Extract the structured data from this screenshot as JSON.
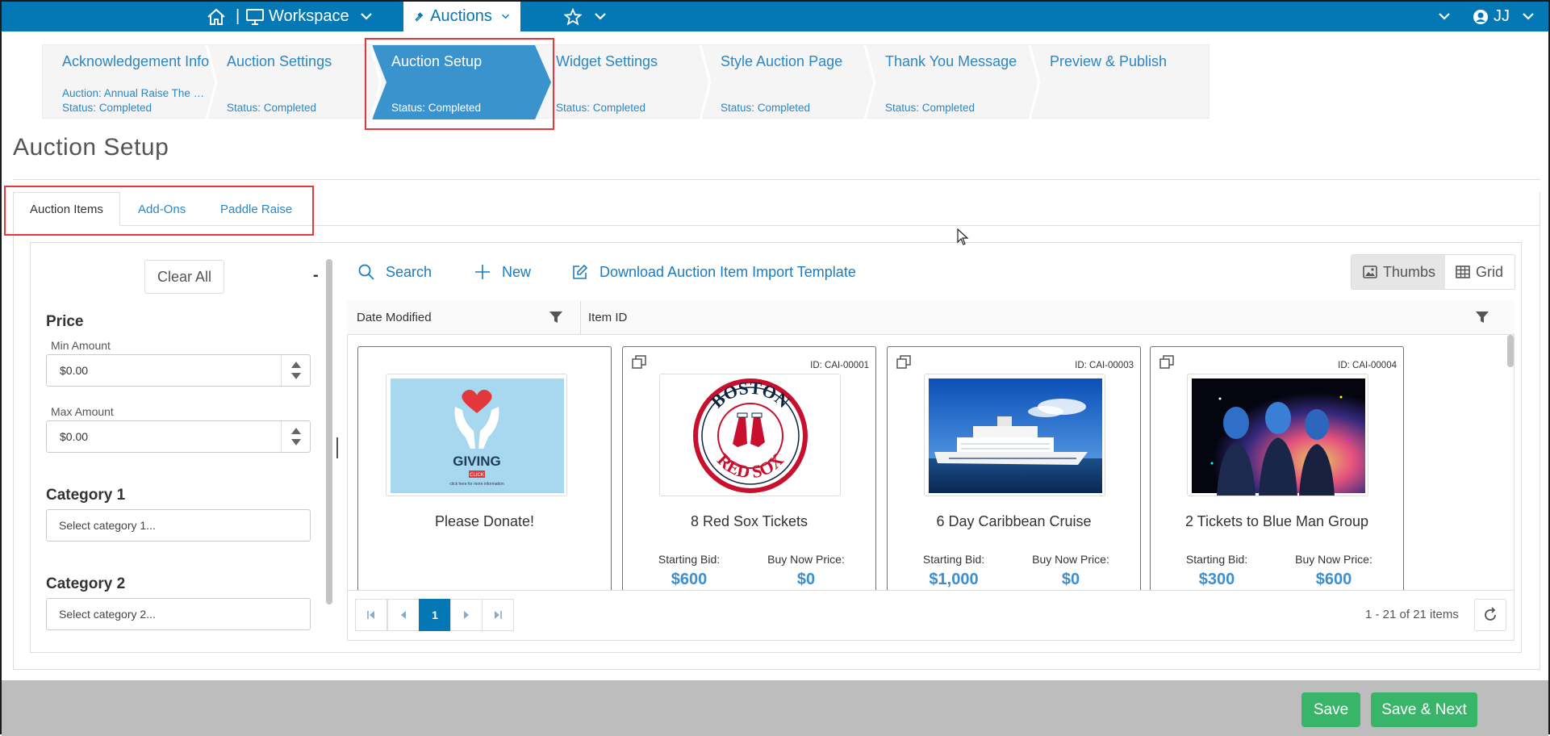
{
  "topnav": {
    "workspace_label": "Workspace",
    "auctions_label": "Auctions",
    "user_initials": "JJ",
    "separator": "|"
  },
  "wizard": {
    "steps": [
      {
        "title": "Acknowledgement Info",
        "subtitle": "Auction: Annual Raise The Paddle",
        "status": "Status: Completed"
      },
      {
        "title": "Auction Settings",
        "subtitle": "",
        "status": "Status: Completed"
      },
      {
        "title": "Auction Setup",
        "subtitle": "",
        "status": "Status: Completed"
      },
      {
        "title": "Widget Settings",
        "subtitle": "",
        "status": "Status: Completed"
      },
      {
        "title": "Style Auction Page",
        "subtitle": "",
        "status": "Status: Completed"
      },
      {
        "title": "Thank You Message",
        "subtitle": "",
        "status": "Status: Completed"
      },
      {
        "title": "Preview & Publish",
        "subtitle": "",
        "status": ""
      }
    ],
    "current_index": 2
  },
  "page": {
    "title": "Auction Setup"
  },
  "tabs": [
    "Auction Items",
    "Add-Ons",
    "Paddle Raise"
  ],
  "filters": {
    "clear_all": "Clear All",
    "collapse": "-",
    "price_label": "Price",
    "min_label": "Min Amount",
    "min_value": "$0.00",
    "max_label": "Max Amount",
    "max_value": "$0.00",
    "category1_label": "Category 1",
    "category1_placeholder": "Select category 1...",
    "category2_label": "Category 2",
    "category2_placeholder": "Select category 2..."
  },
  "toolbar": {
    "search": "Search",
    "new": "New",
    "download": "Download Auction Item Import Template",
    "thumbs": "Thumbs",
    "grid": "Grid"
  },
  "grid": {
    "columns": [
      "Date Modified",
      "Item ID"
    ]
  },
  "items": [
    {
      "id": "",
      "name": "Please Donate!",
      "starting_label": "",
      "starting_bid": "",
      "buynow_label": "",
      "buynow_price": "",
      "image_text": "GIVING",
      "image_button": "CLICK",
      "image_caption": "click here for more information"
    },
    {
      "id": "ID: CAI-00001",
      "name": "8 Red Sox Tickets",
      "starting_label": "Starting Bid:",
      "starting_bid": "$600",
      "buynow_label": "Buy Now Price:",
      "buynow_price": "$0",
      "logo_top": "BOSTON",
      "logo_bottom": "RED SOX"
    },
    {
      "id": "ID: CAI-00003",
      "name": "6 Day Caribbean Cruise",
      "starting_label": "Starting Bid:",
      "starting_bid": "$1,000",
      "buynow_label": "Buy Now Price:",
      "buynow_price": "$0"
    },
    {
      "id": "ID: CAI-00004",
      "name": "2 Tickets to Blue Man Group",
      "starting_label": "Starting Bid:",
      "starting_bid": "$300",
      "buynow_label": "Buy Now Price:",
      "buynow_price": "$600"
    }
  ],
  "pager": {
    "current_page": "1",
    "info": "1 - 21 of 21 items"
  },
  "footer": {
    "save": "Save",
    "save_next": "Save & Next"
  },
  "colors": {
    "brand": "#0378b5",
    "link": "#2b87c5",
    "price": "#3b8fd0",
    "success": "#39b56a",
    "highlight": "#e2383c"
  }
}
